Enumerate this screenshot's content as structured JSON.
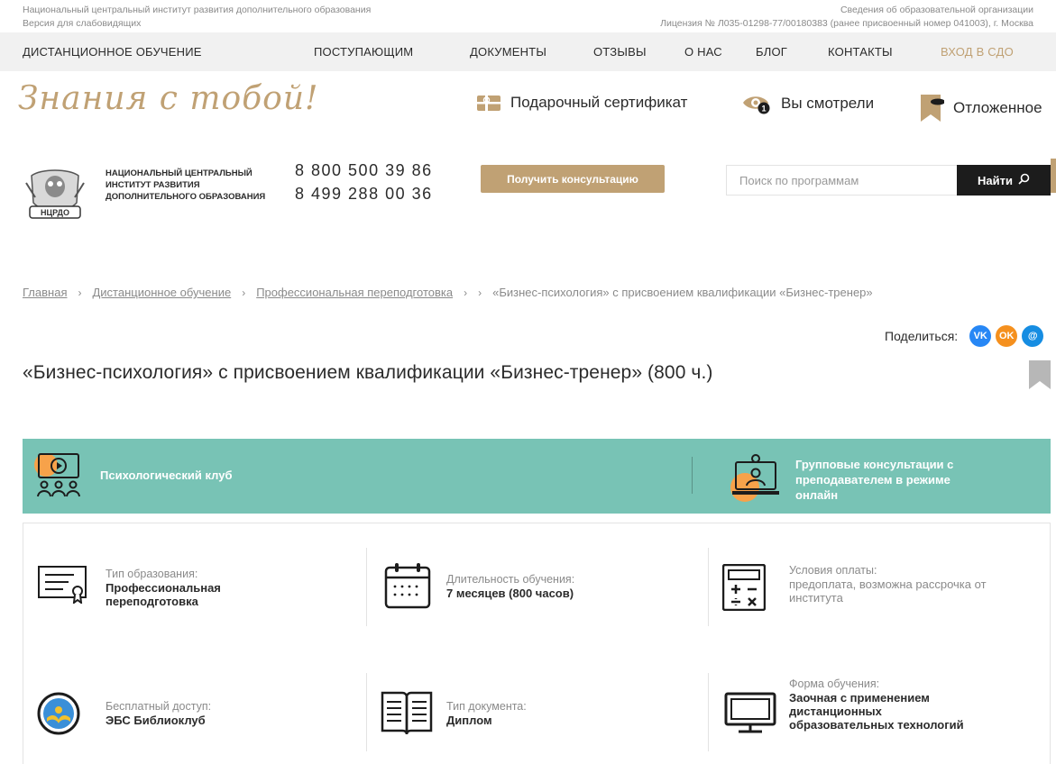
{
  "topinfo": {
    "left_line1": "Национальный центральный институт развития дополнительного образования",
    "left_line2": "Версия для слабовидящих",
    "right_line1": "Сведения об образовательной организации",
    "right_line2": "Лицензия № Л035-01298-77/00180383 (ранее присвоенный номер 041003), г. Москва"
  },
  "nav": {
    "distance": "ДИСТАНЦИОННОЕ ОБУЧЕНИЕ",
    "applicants": "ПОСТУПАЮЩИМ",
    "documents": "ДОКУМЕНТЫ",
    "reviews": "ОТЗЫВЫ",
    "about": "О НАС",
    "blog": "БЛОГ",
    "contacts": "КОНТАКТЫ",
    "login": "ВХОД В СДО"
  },
  "brand": {
    "slogan": "Знания с тобой!",
    "gift": "Подарочный сертификат",
    "viewed": "Вы смотрели",
    "viewed_count": "1",
    "saved": "Отложенное"
  },
  "contact": {
    "logo_text": "НЦРДО",
    "org_name": "НАЦИОНАЛЬНЫЙ ЦЕНТРАЛЬНЫЙ ИНСТИТУТ РАЗВИТИЯ ДОПОЛНИТЕЛЬНОГО ОБРАЗОВАНИЯ",
    "phone1": "8 800 500 39 86",
    "phone2": "8 499 288 00 36",
    "consult_button": "Получить консультацию",
    "search_placeholder": "Поиск по программам",
    "search_button": "Найти"
  },
  "breadcrumb": {
    "home": "Главная",
    "distance": "Дистанционное обучение",
    "retraining": "Профессиональная переподготовка",
    "current": "«Бизнес-психология» с присвоением квалификации «Бизнес-тренер»"
  },
  "share": {
    "label": "Поделиться:",
    "vk": "VK",
    "ok": "OK",
    "mm": "@"
  },
  "page": {
    "title": "«Бизнес-психология» с присвоением квалификации «Бизнес-тренер» (800 ч.)"
  },
  "banner": {
    "club": "Психологический клуб",
    "group": "Групповые консультации с преподавателем в режиме онлайн"
  },
  "info": {
    "edu_type_label": "Тип образования:",
    "edu_type_value": "Профессиональная переподготовка",
    "duration_label": "Длительность обучения:",
    "duration_value": "7 месяцев (800 часов)",
    "payment_label": "Условия оплаты:",
    "payment_value": "предоплата, возможна рассрочка от института",
    "free_label": "Бесплатный доступ:",
    "free_value": "ЭБС Библиоклуб",
    "doc_label": "Тип документа:",
    "doc_value": "Диплом",
    "form_label": "Форма обучения:",
    "form_value": "Заочная с применением дистанционных образовательных технологий"
  },
  "colors": {
    "gold": "#c0a174",
    "teal": "#78c3b5",
    "orange": "#f7a24a",
    "dark": "#1c1c1c",
    "vk": "#2787f5",
    "ok": "#f5901e",
    "mm": "#168de2"
  }
}
